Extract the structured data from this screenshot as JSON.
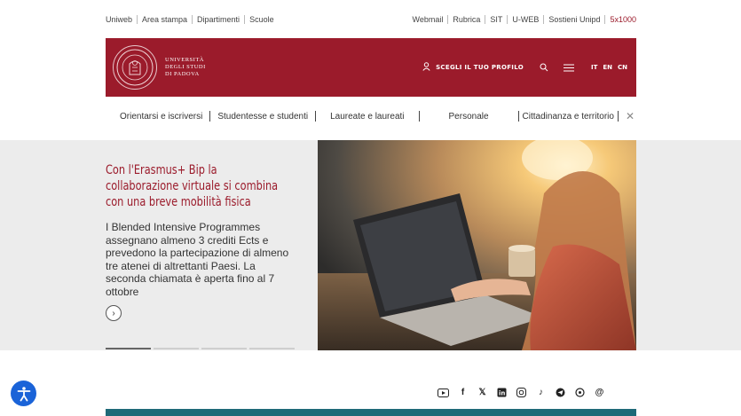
{
  "topbar": {
    "left_links": [
      "Uniweb",
      "Area stampa",
      "Dipartimenti",
      "Scuole"
    ],
    "right_links": [
      "Webmail",
      "Rubrica",
      "SIT",
      "U-WEB",
      "Sostieni Unipd"
    ],
    "accent_link": "5x1000"
  },
  "header": {
    "brand_line1": "UNIVERSITÀ",
    "brand_line2": "DEGLI STUDI",
    "brand_line3": "DI PADOVA",
    "profile_label": "SCEGLI IL TUO PROFILO",
    "languages": [
      "IT",
      "EN",
      "CN"
    ],
    "color": "#9b1b2b"
  },
  "nav": {
    "items": [
      "Orientarsi e iscriversi",
      "Studentesse e studenti",
      "Laureate e laureati",
      "Personale",
      "Cittadinanza e territorio"
    ]
  },
  "hero": {
    "title": "Con l'Erasmus+ Bip la collaborazione virtuale si combina con una breve mobilità fisica",
    "body": "I Blended Intensive Programmes assegnano almeno 3 crediti Ects e prevedono la partecipazione di almeno tre atenei di altrettanti Paesi. La seconda chiamata è aperta fino al 7 ottobre",
    "slides": 4,
    "active_slide": 1
  },
  "socials": [
    "youtube-icon",
    "facebook-icon",
    "x-icon",
    "linkedin-icon",
    "instagram-icon",
    "tiktok-icon",
    "telegram-icon",
    "whatsapp-icon",
    "threads-icon"
  ]
}
